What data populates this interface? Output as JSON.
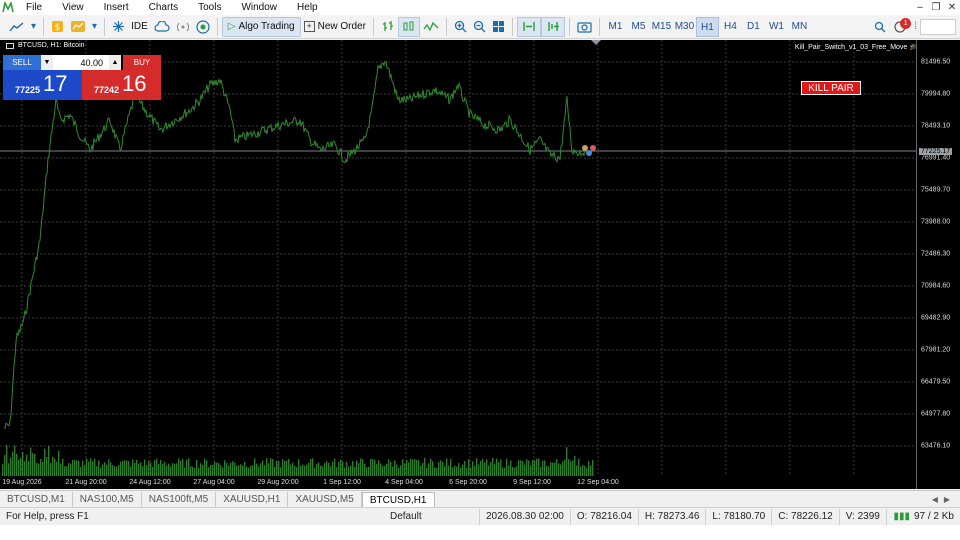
{
  "menu": {
    "items": [
      "File",
      "View",
      "Insert",
      "Charts",
      "Tools",
      "Window",
      "Help"
    ]
  },
  "toolbar": {
    "ide_label": "IDE",
    "algo_trading_label": "Algo Trading",
    "new_order_label": "New Order",
    "timeframes": [
      "M1",
      "M5",
      "M15",
      "M30",
      "H1",
      "H4",
      "D1",
      "W1",
      "MN"
    ],
    "active_timeframe": "H1",
    "notification_count": "1"
  },
  "chart": {
    "title": "BTCUSD, H1:  Bitcoin",
    "ea_label": "Kill_Pair_Switch_v1_03_Free_Move",
    "kill_button_label": "KILL PAIR",
    "current_price_label": "77225.17",
    "price_labels": [
      "81496.50",
      "79994.80",
      "78493.10",
      "76991.40",
      "75489.70",
      "73988.00",
      "72486.30",
      "70984.60",
      "69482.90",
      "67981.20",
      "66479.50",
      "64977.80",
      "63476.10"
    ],
    "time_labels": [
      "19 Aug 2026",
      "21 Aug 20:00",
      "24 Aug 12:00",
      "27 Aug 04:00",
      "29 Aug 20:00",
      "1 Sep 12:00",
      "4 Sep 04:00",
      "6 Sep 20:00",
      "9 Sep 12:00",
      "12 Sep 04:00"
    ],
    "line_color": "#2e8b2e",
    "volume_color": "#2f7a2f"
  },
  "trade_panel": {
    "sell_label": "SELL",
    "buy_label": "BUY",
    "lot_value": "40.00",
    "bid_small": "77225",
    "bid_big": "17",
    "ask_small": "77242",
    "ask_big": "16"
  },
  "tabs": [
    "BTCUSD,M1",
    "NAS100,M5",
    "NAS100ft,M5",
    "XAUUSD,H1",
    "XAUUSD,M5",
    "BTCUSD,H1"
  ],
  "active_tab": "BTCUSD,H1",
  "status": {
    "help": "For Help, press F1",
    "profile": "Default",
    "datetime": "2026.08.30 02:00",
    "open": "O: 78216.04",
    "high": "H: 78273.46",
    "low": "L: 78180.70",
    "close": "C: 78226.12",
    "volume": "V: 2399",
    "traffic": "97 / 2 Kb"
  }
}
